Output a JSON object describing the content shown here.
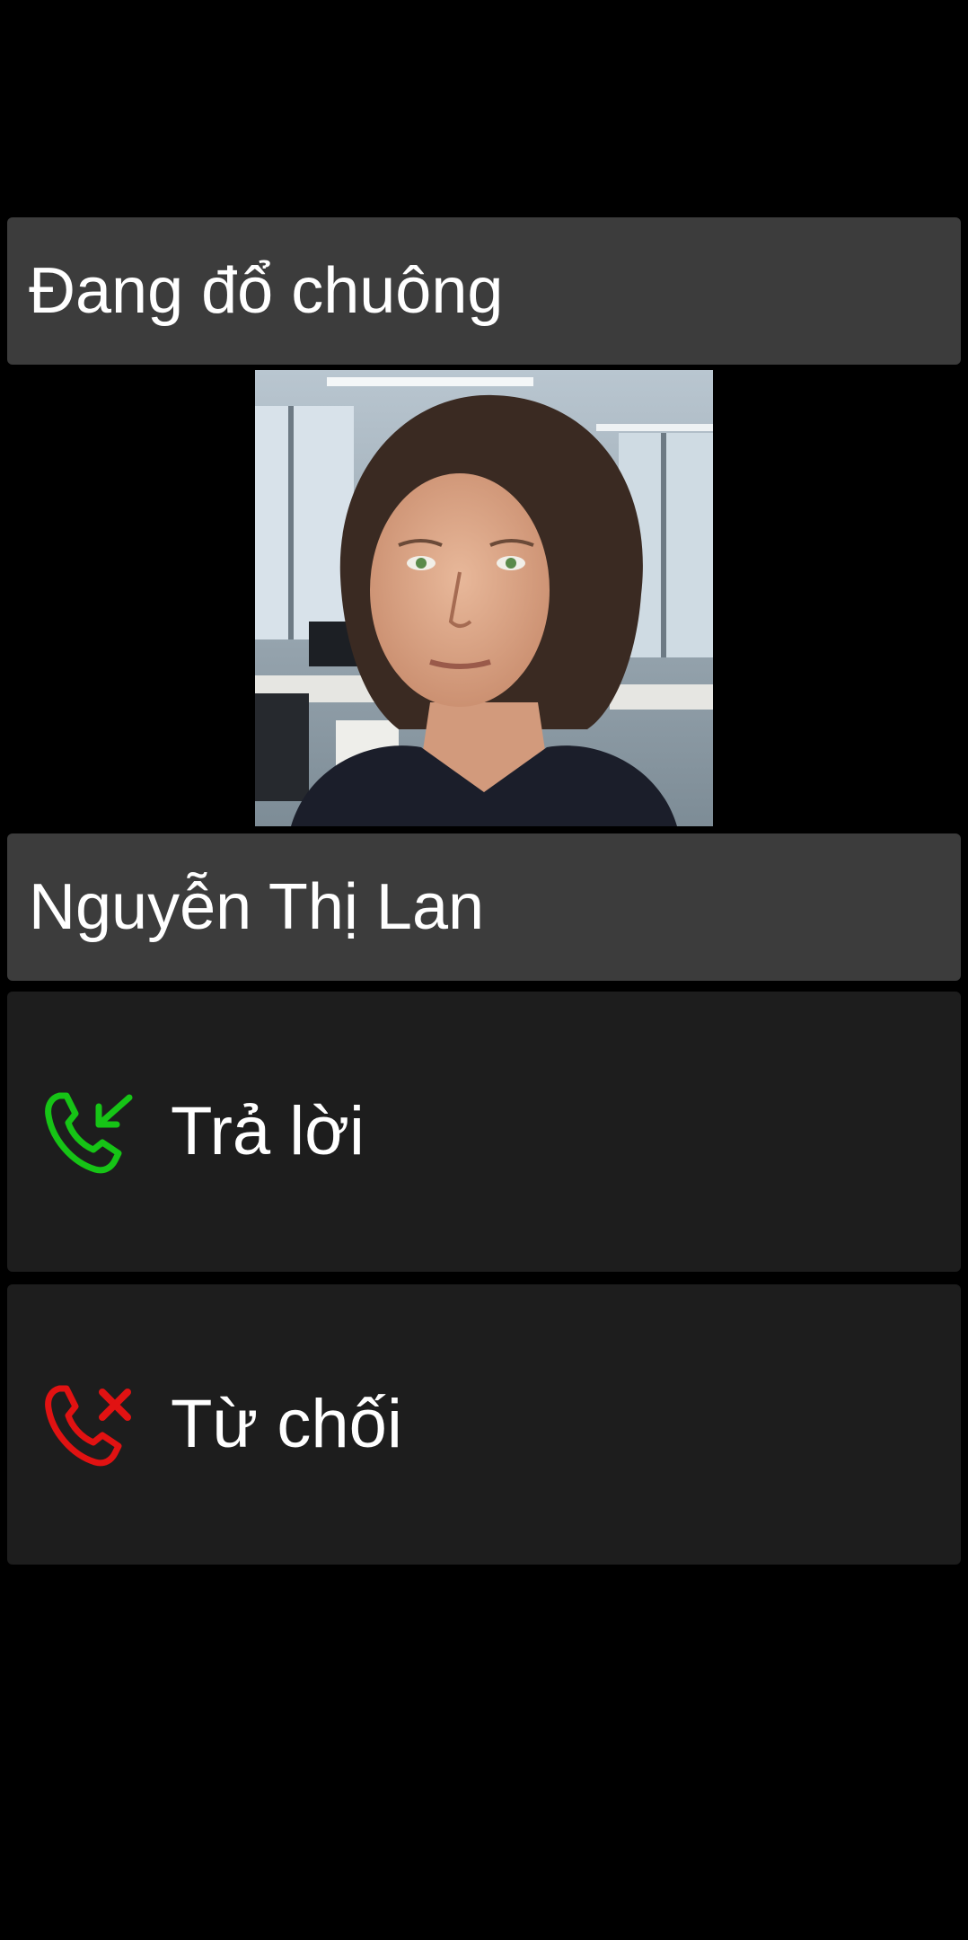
{
  "call": {
    "status": "Đang đổ chuông",
    "caller_name": "Nguyễn Thị Lan"
  },
  "actions": {
    "answer_label": "Trả lời",
    "answer_icon": "incoming-call-icon",
    "answer_color": "#16c416",
    "decline_label": "Từ chối",
    "decline_icon": "decline-call-icon",
    "decline_color": "#e11212"
  },
  "colors": {
    "background": "#000000",
    "bar": "#3c3c3c",
    "button": "#1d1d1d",
    "text": "#ffffff"
  }
}
